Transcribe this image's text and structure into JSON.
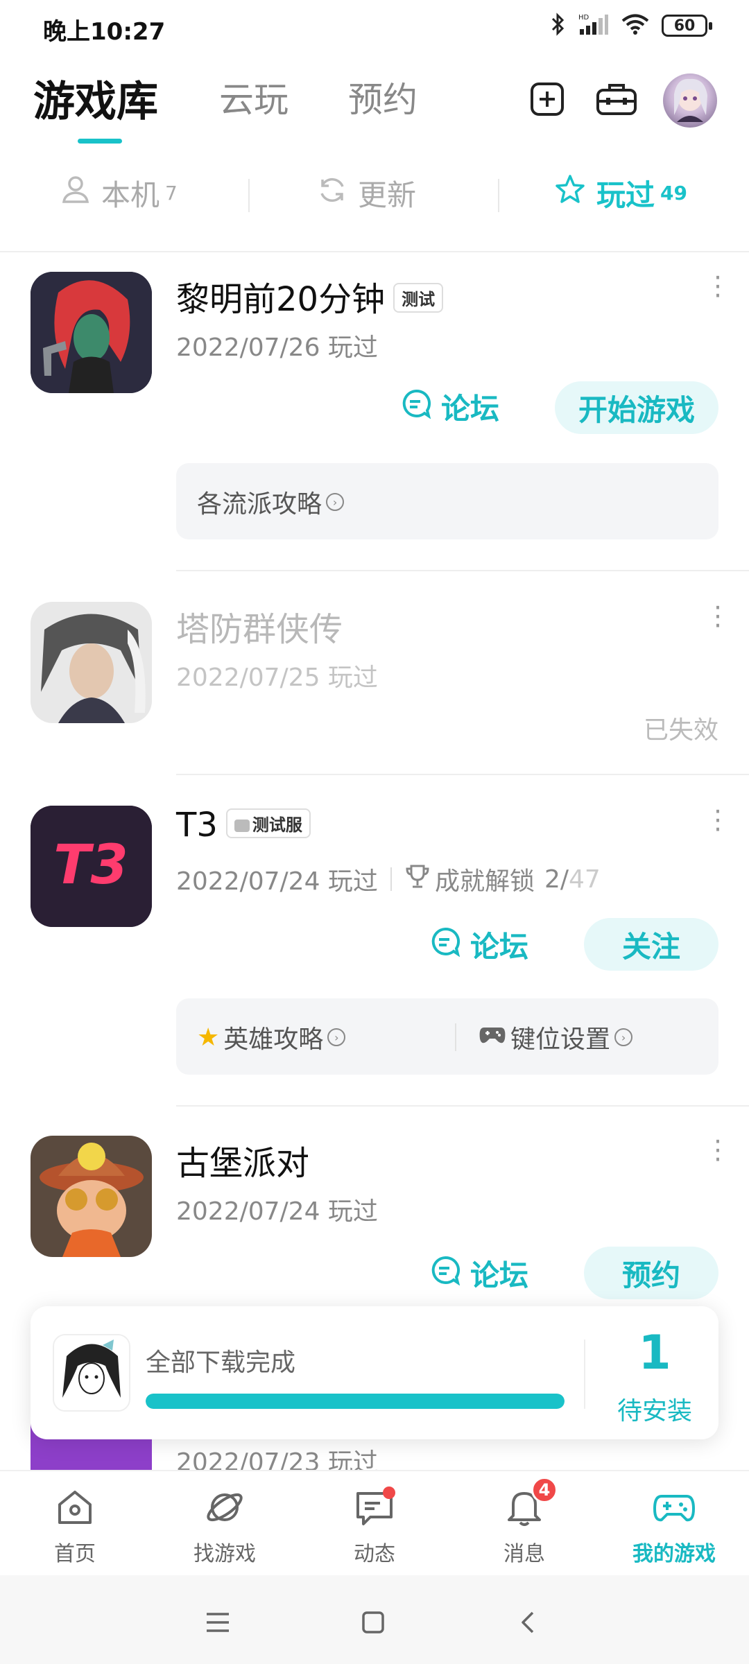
{
  "status_bar": {
    "time": "晚上10:27",
    "battery": "60"
  },
  "header": {
    "tabs": [
      {
        "label": "游戏库",
        "active": true
      },
      {
        "label": "云玩",
        "active": false
      },
      {
        "label": "预约",
        "active": false
      }
    ],
    "icons": [
      "add-icon",
      "toolbox-icon",
      "avatar"
    ]
  },
  "filters": [
    {
      "label": "本机",
      "count": "7",
      "icon": "phone-user-icon",
      "active": false
    },
    {
      "label": "更新",
      "count": "",
      "icon": "refresh-icon",
      "active": false
    },
    {
      "label": "玩过",
      "count": "49",
      "icon": "star-icon",
      "active": true
    }
  ],
  "games": [
    {
      "title": "黎明前20分钟",
      "tag": "测试",
      "played": "2022/07/26 玩过",
      "forum_label": "论坛",
      "action_label": "开始游戏",
      "guides": [
        "各流派攻略"
      ]
    },
    {
      "title": "塔防群侠传",
      "played": "2022/07/25 玩过",
      "status": "已失效"
    },
    {
      "title": "T3",
      "tag": "测试服",
      "played": "2022/07/24 玩过",
      "achievement_label": "成就解锁",
      "achievement_done": "2/",
      "achievement_total": "47",
      "forum_label": "论坛",
      "action_label": "关注",
      "guides": [
        "英雄攻略",
        "键位设置"
      ]
    },
    {
      "title": "古堡派对",
      "played": "2022/07/24 玩过",
      "forum_label": "论坛",
      "action_label": "预约"
    },
    {
      "played": "2022/07/23 玩过"
    }
  ],
  "download": {
    "title": "全部下载完成",
    "progress": 1.0,
    "count": "1",
    "label": "待安装"
  },
  "bottom_nav": [
    {
      "label": "首页",
      "icon": "home-icon"
    },
    {
      "label": "找游戏",
      "icon": "planet-icon"
    },
    {
      "label": "动态",
      "icon": "chat-icon",
      "dot": true
    },
    {
      "label": "消息",
      "icon": "bell-icon",
      "badge": "4"
    },
    {
      "label": "我的游戏",
      "icon": "gamepad-icon",
      "active": true
    }
  ],
  "colors": {
    "accent": "#19c2c9",
    "badge": "#f04848"
  }
}
